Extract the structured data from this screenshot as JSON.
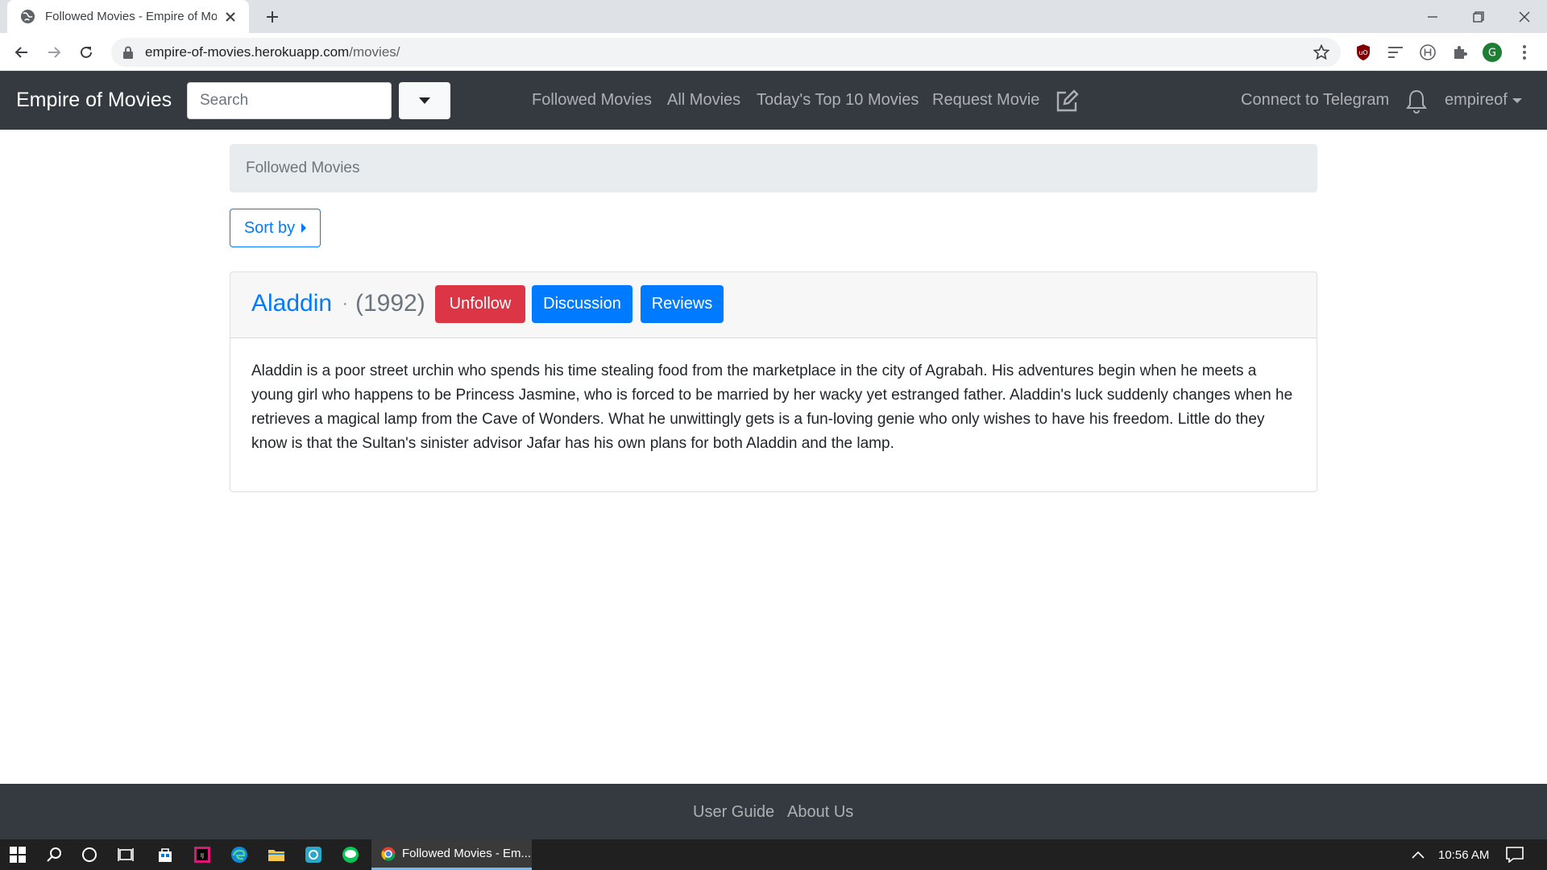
{
  "browser": {
    "tab_title": "Followed Movies - Empire of Mo",
    "url_host": "empire-of-movies.herokuapp.com",
    "url_path": "/movies/"
  },
  "navbar": {
    "brand": "Empire of Movies",
    "search_placeholder": "Search",
    "links": {
      "followed": "Followed Movies",
      "all": "All Movies",
      "top10": "Today's Top 10 Movies",
      "request": "Request Movie",
      "telegram": "Connect to Telegram"
    },
    "user": "empireof"
  },
  "breadcrumb": "Followed Movies",
  "sort_label": "Sort by",
  "movie": {
    "title": "Aladdin",
    "separator": "·",
    "year": "(1992)",
    "unfollow_label": "Unfollow",
    "discussion_label": "Discussion",
    "reviews_label": "Reviews",
    "description": "Aladdin is a poor street urchin who spends his time stealing food from the marketplace in the city of Agrabah. His adventures begin when he meets a young girl who happens to be Princess Jasmine, who is forced to be married by her wacky yet estranged father. Aladdin's luck suddenly changes when he retrieves a magical lamp from the Cave of Wonders. What he unwittingly gets is a fun-loving genie who only wishes to have his freedom. Little do they know is that the Sultan's sinister advisor Jafar has his own plans for both Aladdin and the lamp."
  },
  "footer": {
    "user_guide": "User Guide",
    "about": "About Us"
  },
  "taskbar": {
    "active_app": "Followed Movies - Em...",
    "time": "10:56 AM"
  },
  "colors": {
    "navbar_bg": "#343a40",
    "primary": "#007bff",
    "danger": "#dc3545",
    "breadcrumb_bg": "#e9ecef"
  }
}
